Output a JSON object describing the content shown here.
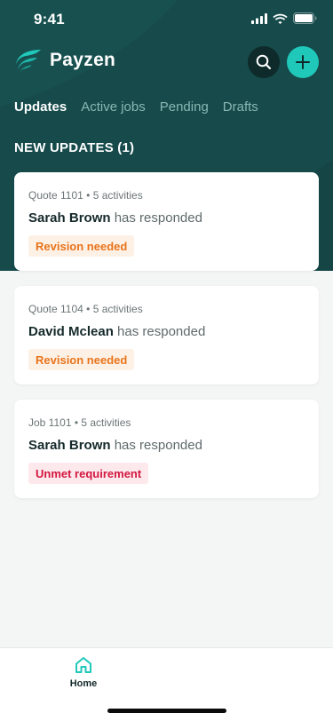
{
  "status_bar": {
    "time": "9:41"
  },
  "app": {
    "brand": "Payzen"
  },
  "tabs": [
    {
      "label": "Updates",
      "active": true
    },
    {
      "label": "Active jobs",
      "active": false
    },
    {
      "label": "Pending",
      "active": false
    },
    {
      "label": "Drafts",
      "active": false
    }
  ],
  "section": {
    "title": "NEW UPDATES (1)"
  },
  "cards": [
    {
      "meta": "Quote 1101 • 5 activities",
      "name": "Sarah Brown",
      "action": " has responded",
      "badge": "Revision needed",
      "badge_type": "revision"
    },
    {
      "meta": "Quote 1104 • 5 activities",
      "name": "David Mclean",
      "action": " has responded",
      "badge": "Revision needed",
      "badge_type": "revision"
    },
    {
      "meta": "Job 1101 • 5 activities",
      "name": "Sarah Brown",
      "action": " has responded",
      "badge": "Unmet requirement",
      "badge_type": "unmet"
    }
  ],
  "bottom_nav": {
    "home_label": "Home"
  },
  "colors": {
    "header_bg": "#164a4b",
    "accent": "#1fc8b8",
    "revision_text": "#e8741b",
    "revision_bg": "#fdf1e6",
    "unmet_text": "#d3163f",
    "unmet_bg": "#fde8ec"
  },
  "icons": {
    "search": "search-icon",
    "add": "plus-icon",
    "home": "home-icon",
    "logo": "payzen-logo-icon"
  }
}
